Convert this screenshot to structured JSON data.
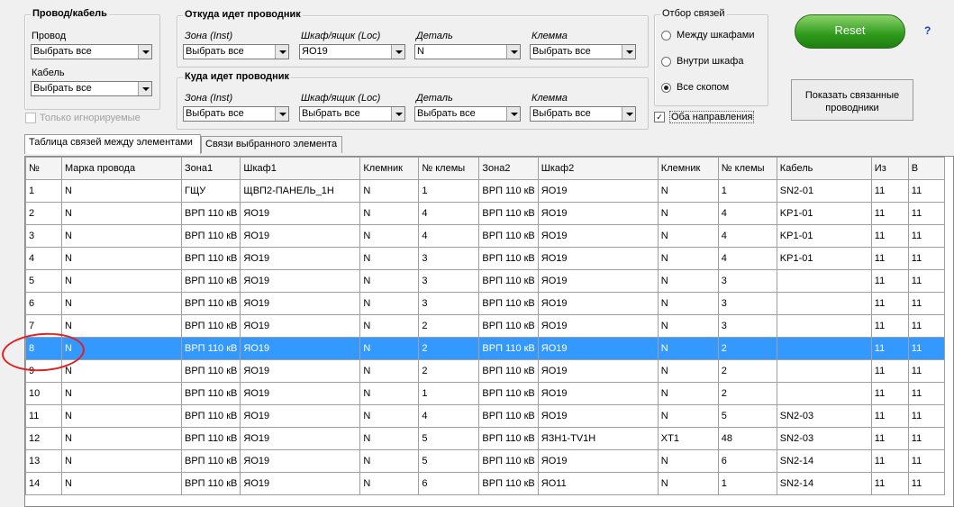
{
  "wire_cable": {
    "title": "Провод/кабель",
    "wire_label": "Провод",
    "wire_value": "Выбрать все",
    "cable_label": "Кабель",
    "cable_value": "Выбрать все",
    "ignored_label": "Только игнорируемые"
  },
  "from": {
    "title": "Откуда идет проводник",
    "zone_label": "Зона (Inst)",
    "zone_value": "Выбрать все",
    "cab_label": "Шкаф/ящик (Loc)",
    "cab_value": "ЯО19",
    "detail_label": "Деталь",
    "detail_value": "N",
    "term_label": "Клемма",
    "term_value": "Выбрать все"
  },
  "to": {
    "title": "Куда идет проводник",
    "zone_label": "Зона (Inst)",
    "zone_value": "Выбрать все",
    "cab_label": "Шкаф/ящик (Loc)",
    "cab_value": "Выбрать все",
    "detail_label": "Деталь",
    "detail_value": "Выбрать все",
    "term_label": "Клемма",
    "term_value": "Выбрать все"
  },
  "selection": {
    "title": "Отбор связей",
    "opt1": "Между шкафами",
    "opt2": "Внутри шкафа",
    "opt3": "Все скопом",
    "both_dirs": "Оба направления"
  },
  "buttons": {
    "reset": "Reset",
    "help": "?",
    "show_linked": "Показать связанные проводники"
  },
  "tabs": [
    "Таблица связей между элементами",
    "Связи выбранного элемента"
  ],
  "table": {
    "headers": [
      "№",
      "Марка провода",
      "Зона1",
      "Шкаф1",
      "Клемник",
      "№ клемы",
      "Зона2",
      "Шкаф2",
      "Клемник",
      "№ клемы",
      "Кабель",
      "Из",
      "В"
    ],
    "rows": [
      [
        "1",
        "N",
        "ГЩУ",
        "ЩВП2-ПАНЕЛЬ_1Н",
        "N",
        "1",
        "ВРП 110 кВ",
        "ЯО19",
        "N",
        "1",
        "SN2-01",
        "11",
        "11"
      ],
      [
        "2",
        "N",
        "ВРП 110 кВ",
        "ЯО19",
        "N",
        "4",
        "ВРП 110 кВ",
        "ЯО19",
        "N",
        "4",
        "KP1-01",
        "11",
        "11"
      ],
      [
        "3",
        "N",
        "ВРП 110 кВ",
        "ЯО19",
        "N",
        "4",
        "ВРП 110 кВ",
        "ЯО19",
        "N",
        "4",
        "KP1-01",
        "11",
        "11"
      ],
      [
        "4",
        "N",
        "ВРП 110 кВ",
        "ЯО19",
        "N",
        "3",
        "ВРП 110 кВ",
        "ЯО19",
        "N",
        "4",
        "KP1-01",
        "11",
        "11"
      ],
      [
        "5",
        "N",
        "ВРП 110 кВ",
        "ЯО19",
        "N",
        "3",
        "ВРП 110 кВ",
        "ЯО19",
        "N",
        "3",
        "",
        "11",
        "11"
      ],
      [
        "6",
        "N",
        "ВРП 110 кВ",
        "ЯО19",
        "N",
        "3",
        "ВРП 110 кВ",
        "ЯО19",
        "N",
        "3",
        "",
        "11",
        "11"
      ],
      [
        "7",
        "N",
        "ВРП 110 кВ",
        "ЯО19",
        "N",
        "2",
        "ВРП 110 кВ",
        "ЯО19",
        "N",
        "3",
        "",
        "11",
        "11"
      ],
      [
        "8",
        "N",
        "ВРП 110 кВ",
        "ЯО19",
        "N",
        "2",
        "ВРП 110 кВ",
        "ЯО19",
        "N",
        "2",
        "",
        "11",
        "11"
      ],
      [
        "9",
        "N",
        "ВРП 110 кВ",
        "ЯО19",
        "N",
        "2",
        "ВРП 110 кВ",
        "ЯО19",
        "N",
        "2",
        "",
        "11",
        "11"
      ],
      [
        "10",
        "N",
        "ВРП 110 кВ",
        "ЯО19",
        "N",
        "1",
        "ВРП 110 кВ",
        "ЯО19",
        "N",
        "2",
        "",
        "11",
        "11"
      ],
      [
        "11",
        "N",
        "ВРП 110 кВ",
        "ЯО19",
        "N",
        "4",
        "ВРП 110 кВ",
        "ЯО19",
        "N",
        "5",
        "SN2-03",
        "11",
        "11"
      ],
      [
        "12",
        "N",
        "ВРП 110 кВ",
        "ЯО19",
        "N",
        "5",
        "ВРП 110 кВ",
        "ЯЗН1-TV1H",
        "XT1",
        "48",
        "SN2-03",
        "11",
        "11"
      ],
      [
        "13",
        "N",
        "ВРП 110 кВ",
        "ЯО19",
        "N",
        "5",
        "ВРП 110 кВ",
        "ЯО19",
        "N",
        "6",
        "SN2-14",
        "11",
        "11"
      ],
      [
        "14",
        "N",
        "ВРП 110 кВ",
        "ЯО19",
        "N",
        "6",
        "ВРП 110 кВ",
        "ЯО11",
        "N",
        "1",
        "SN2-14",
        "11",
        "11"
      ]
    ],
    "selected_row": 8
  }
}
